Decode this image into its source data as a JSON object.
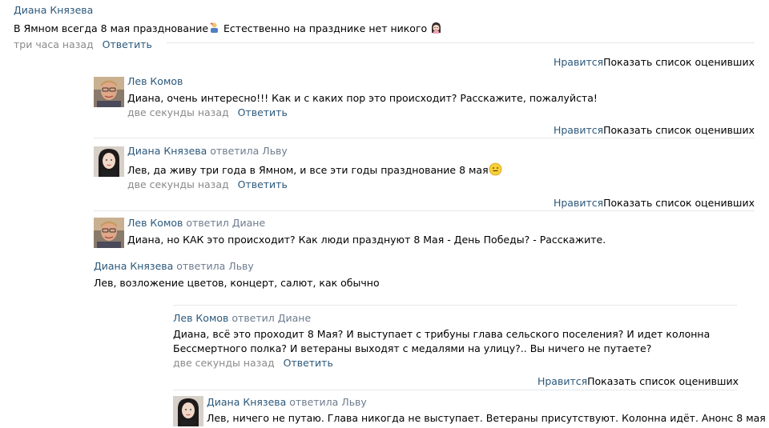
{
  "comments": [
    {
      "author": "Диана Князева",
      "text": "В Ямном всегда 8 мая празднование",
      "text_after_icon": " Естественно на празднике нет никого",
      "time": "три часа назад",
      "reply": "Ответить"
    },
    {
      "author": "Лев Комов",
      "text": "Диана, очень интересно!!! Как и с каких пор это происходит? Расскажите, пожалуйста!",
      "time": "две секунды назад",
      "reply": "Ответить"
    },
    {
      "author": "Диана Князева",
      "reply_to": "ответила Льву",
      "text": "Лев, да живу три года в Ямном, и все эти годы празднование 8 мая",
      "time": "две секунды назад",
      "reply": "Ответить"
    },
    {
      "author": "Лев Комов",
      "reply_to": "ответил Диане",
      "text": "Диана, но КАК это происходит? Как люди празднуют 8 Мая - День Победы? - Расскажите."
    },
    {
      "author": "Диана Князева",
      "reply_to": "ответила Льву",
      "text": "Лев, возложение цветов, концерт, салют, как обычно"
    },
    {
      "author": "Лев Комов",
      "reply_to": "ответил Диане",
      "text_line1": "Диана, всё это проходит 8 Мая? И выступает с трибуны глава сельского поселения? И идет колонна",
      "text_line2": "Бессмертного полка? И ветераны выходят с медалями на улицу?.. Вы ничего не путаете?",
      "time": "две секунды назад",
      "reply": "Ответить"
    },
    {
      "author": "Диана Князева",
      "reply_to": "ответила Льву",
      "text": "Лев, ничего не путаю. Глава никогда не выступает. Ветераны присутствуют. Колонна идёт. Анонс 8 мая"
    }
  ],
  "likes": {
    "like_label": "Нравится",
    "show_list_label": "Показать список оценивших"
  },
  "icons": {
    "party_icon": "party-person-icon",
    "girl_icon": "girl-face-icon",
    "smile_icon": "smile-emoji-icon"
  },
  "colors": {
    "link": "#2b587a",
    "meta": "#8a8a8a",
    "separator": "#e3e6ea"
  }
}
